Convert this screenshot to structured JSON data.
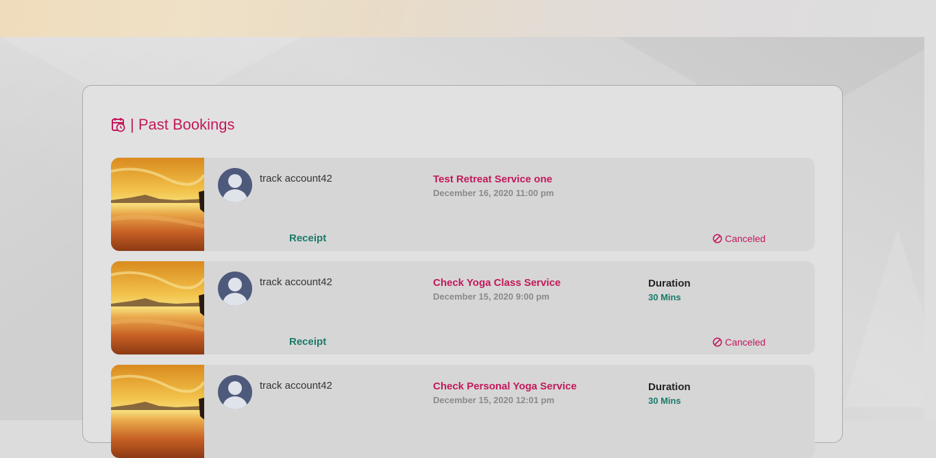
{
  "page": {
    "section_title": "| Past Bookings",
    "header_icon": "calendar-clock-icon"
  },
  "colors": {
    "accent": "#c2185b",
    "link": "#1a7a6a",
    "card_bg": "#e1e1e1",
    "row_bg": "#d6d6d6",
    "avatar_bg": "#4e5a7c"
  },
  "bookings": [
    {
      "user": "track account42",
      "service": "Test Retreat Service one",
      "date": "December 16, 2020 11:00 pm",
      "receipt_label": "Receipt",
      "status": "Canceled",
      "status_icon": "ban-icon"
    },
    {
      "user": "track account42",
      "service": "Check Yoga Class Service",
      "date": "December 15, 2020 9:00 pm",
      "duration_label": "Duration",
      "duration_value": "30 Mins",
      "receipt_label": "Receipt",
      "status": "Canceled",
      "status_icon": "ban-icon"
    },
    {
      "user": "track account42",
      "service": "Check Personal Yoga Service",
      "date": "December 15, 2020 12:01 pm",
      "duration_label": "Duration",
      "duration_value": "30 Mins"
    }
  ]
}
